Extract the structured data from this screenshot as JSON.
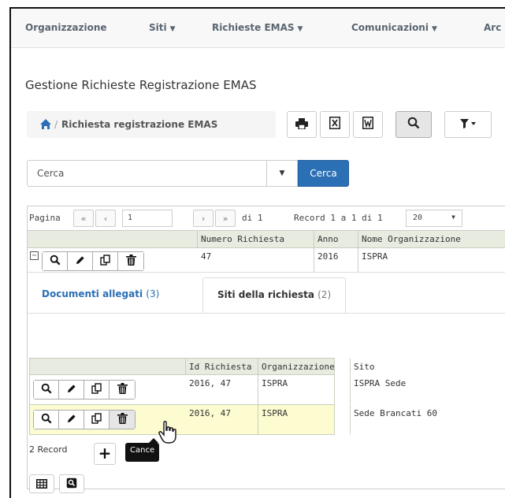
{
  "nav": {
    "items": [
      {
        "label": "Organizzazione",
        "caret": false
      },
      {
        "label": "Siti",
        "caret": true
      },
      {
        "label": "Richieste EMAS",
        "caret": true
      },
      {
        "label": "Comunicazioni",
        "caret": true
      },
      {
        "label": "Arc",
        "caret": false
      }
    ]
  },
  "page": {
    "title": "Gestione Richieste Registrazione EMAS",
    "breadcrumb": {
      "separator": "/",
      "current": "Richiesta registrazione EMAS"
    }
  },
  "toolbar": {
    "icons": [
      "print-icon",
      "excel-icon",
      "word-icon",
      "search-icon",
      "filter-icon"
    ]
  },
  "search": {
    "value": "Cerca",
    "button_label": "Cerca"
  },
  "pager": {
    "label_page": "Pagina",
    "page_value": "1",
    "of_label": "di 1",
    "record_label": "Record 1 a 1 di 1",
    "page_size": "20"
  },
  "main_grid": {
    "columns": [
      "Numero Richiesta",
      "Anno",
      "Nome Organizzazione"
    ],
    "rows": [
      {
        "numero": "47",
        "anno": "2016",
        "organizzazione": "ISPRA"
      }
    ]
  },
  "detail_tabs": [
    {
      "label": "Documenti allegati",
      "count": "(3)",
      "active": false
    },
    {
      "label": "Siti della richiesta",
      "count": "(2)",
      "active": true
    }
  ],
  "sub_grid": {
    "columns": [
      "Id Richiesta",
      "Organizzazione",
      "Sito"
    ],
    "rows": [
      {
        "id": "2016, 47",
        "org": "ISPRA",
        "sito": "ISPRA Sede"
      },
      {
        "id": "2016, 47",
        "org": "ISPRA",
        "sito": "Sede Brancati 60"
      }
    ],
    "record_count": "2 Record",
    "tooltip": "Cance"
  },
  "colors": {
    "primary": "#2b6fb5",
    "header_bg": "#e7ebe0",
    "selected_row": "#fdfbd0"
  }
}
